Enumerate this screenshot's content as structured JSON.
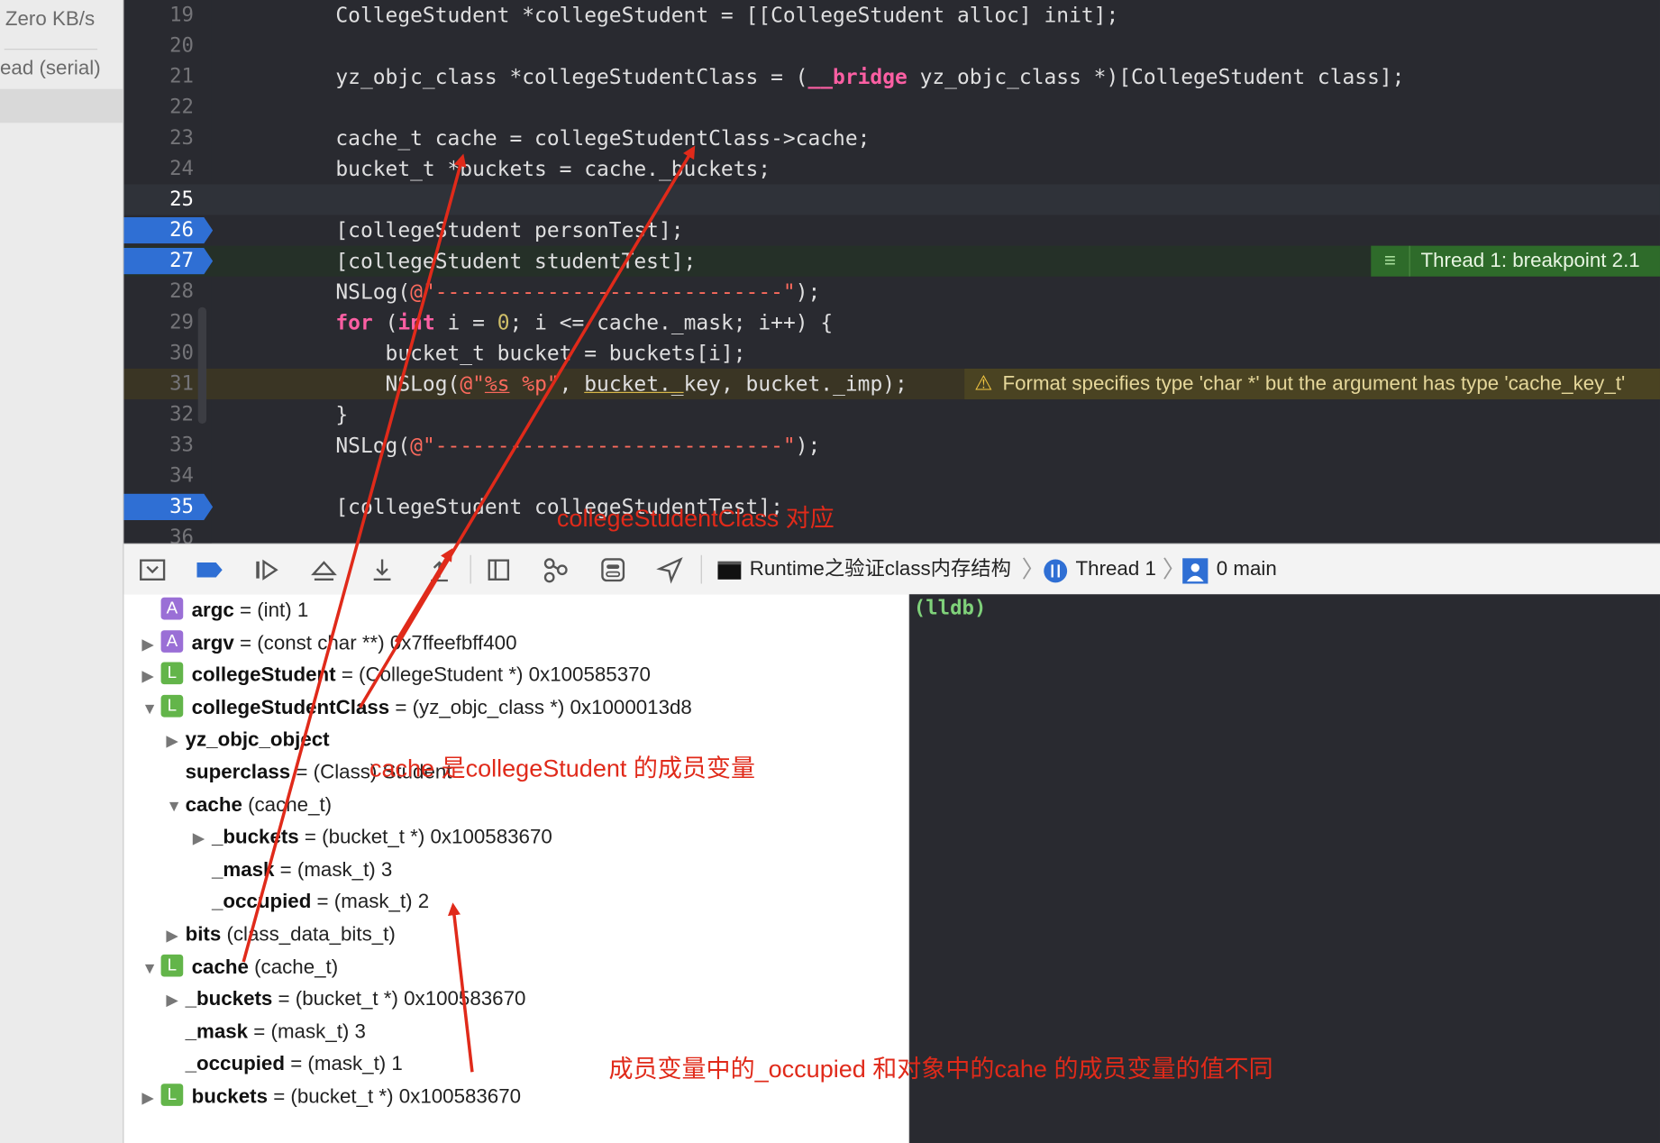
{
  "sidebar": {
    "rate": "Zero KB/s",
    "queue": "ead (serial)"
  },
  "editor": {
    "lines": [
      {
        "n": "19",
        "text": "CollegeStudent *collegeStudent = [[CollegeStudent alloc] init];"
      },
      {
        "n": "20",
        "text": ""
      },
      {
        "n": "21",
        "text": "yz_objc_class *collegeStudentClass = (__bridge yz_objc_class *)[CollegeStudent class];"
      },
      {
        "n": "22",
        "text": ""
      },
      {
        "n": "23",
        "text": "cache_t cache = collegeStudentClass->cache;"
      },
      {
        "n": "24",
        "text": "bucket_t *buckets = cache._buckets;"
      },
      {
        "n": "25",
        "text": ""
      },
      {
        "n": "26",
        "text": "[collegeStudent personTest];"
      },
      {
        "n": "27",
        "text": "[collegeStudent studentTest];"
      },
      {
        "n": "28",
        "text": "NSLog(@\"----------------------------\");"
      },
      {
        "n": "29",
        "text": "for (int i = 0; i <= cache._mask; i++) {"
      },
      {
        "n": "30",
        "text": "    bucket_t bucket = buckets[i];"
      },
      {
        "n": "31",
        "text": "    NSLog(@\"%s %p\", bucket._key, bucket._imp);"
      },
      {
        "n": "32",
        "text": "}"
      },
      {
        "n": "33",
        "text": "NSLog(@\"----------------------------\");"
      },
      {
        "n": "34",
        "text": ""
      },
      {
        "n": "35",
        "text": "[collegeStudent collegeStudentTest];"
      },
      {
        "n": "36",
        "text": ""
      }
    ],
    "breakpoint_banner": "Thread 1: breakpoint 2.1",
    "warning_banner": "Format specifies type 'char *' but the argument has type 'cache_key_t'"
  },
  "toolbar": {
    "process": "Runtime之验证class内存结构",
    "thread": "Thread 1",
    "frame": "0 main"
  },
  "variables": [
    {
      "badge": "A",
      "name": "argc",
      "value": " = (int) 1"
    },
    {
      "badge": "A",
      "name": "argv",
      "value": " = (const char **) 0x7ffeefbff400"
    },
    {
      "badge": "L",
      "name": "collegeStudent",
      "value": " = (CollegeStudent *) 0x100585370"
    },
    {
      "badge": "L",
      "name": "collegeStudentClass",
      "value": " = (yz_objc_class *) 0x1000013d8"
    },
    {
      "badge": "",
      "name": "yz_objc_object",
      "value": ""
    },
    {
      "badge": "",
      "name": "superclass",
      "value": " = (Class) Student"
    },
    {
      "badge": "",
      "name": "cache",
      "value": " (cache_t)"
    },
    {
      "badge": "",
      "name": "_buckets",
      "value": " = (bucket_t *) 0x100583670"
    },
    {
      "badge": "",
      "name": "_mask",
      "value": " = (mask_t) 3"
    },
    {
      "badge": "",
      "name": "_occupied",
      "value": " = (mask_t) 2"
    },
    {
      "badge": "",
      "name": "bits",
      "value": " (class_data_bits_t)"
    },
    {
      "badge": "L",
      "name": "cache",
      "value": " (cache_t)"
    },
    {
      "badge": "",
      "name": "_buckets",
      "value": " = (bucket_t *) 0x100583670"
    },
    {
      "badge": "",
      "name": "_mask",
      "value": " = (mask_t) 3"
    },
    {
      "badge": "",
      "name": "_occupied",
      "value": " = (mask_t) 1"
    },
    {
      "badge": "L",
      "name": "buckets",
      "value": " = (bucket_t *) 0x100583670"
    }
  ],
  "console": {
    "prompt": "(lldb)"
  },
  "annotations": {
    "note1": "collegeStudentClass 对应",
    "note2": "cache 是collegeStudent 的成员变量",
    "note3": "成员变量中的_occupied 和对象中的cahe 的成员变量的值不同"
  },
  "colors": {
    "annotation": "#e02a1a",
    "breakpoint": "#2f6fd4",
    "editor_bg": "#292a30"
  }
}
